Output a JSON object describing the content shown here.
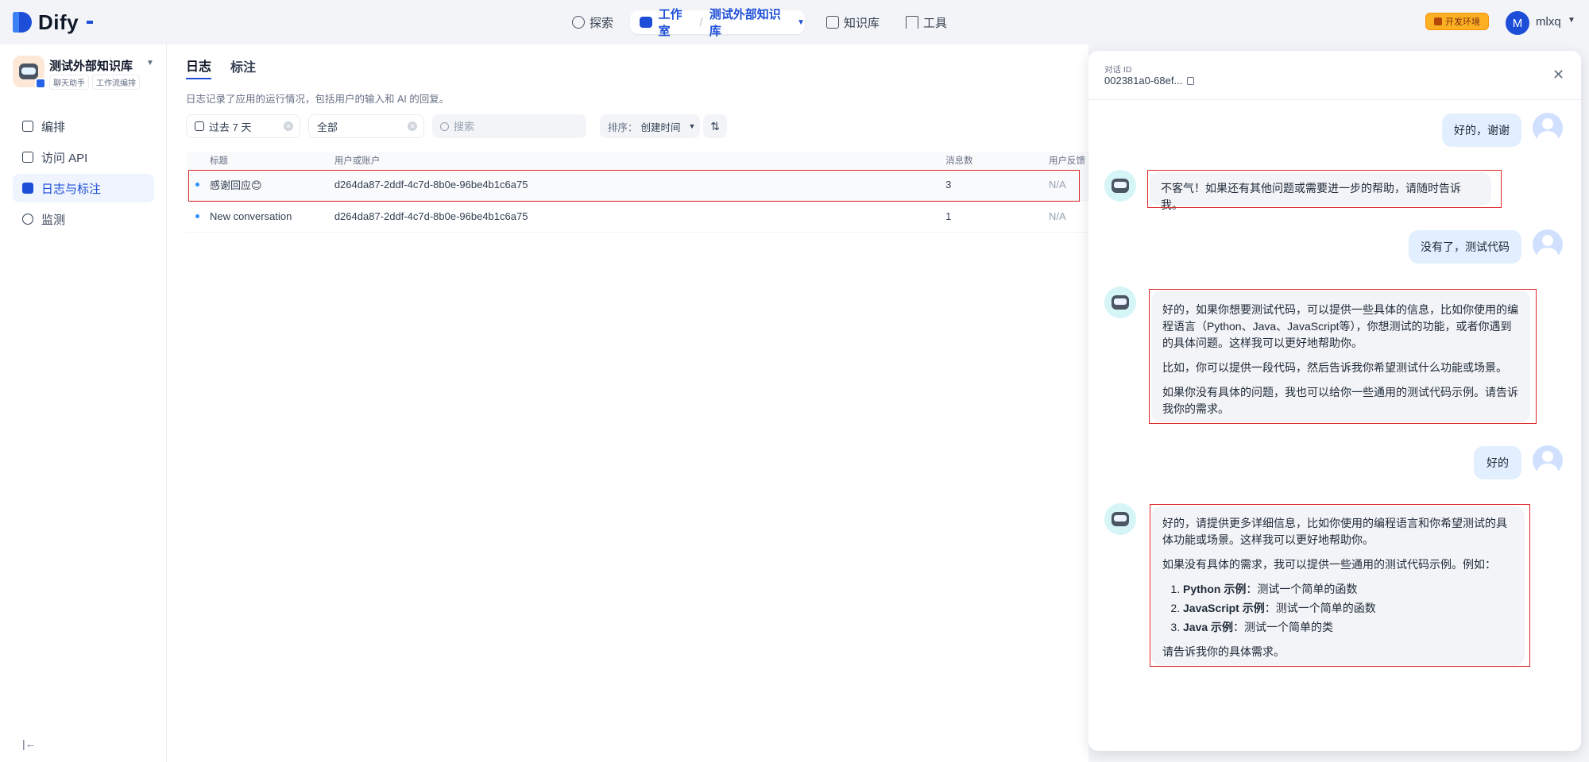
{
  "nav": {
    "logo_text": "Dify",
    "explore": "探索",
    "studio": "工作室",
    "separator": "/",
    "current_app": "测试外部知识库",
    "knowledge": "知识库",
    "tools": "工具",
    "env_badge": "开发环境",
    "user_initial": "M",
    "user_name": "mlxq"
  },
  "sidebar": {
    "app_name": "测试外部知识库",
    "tags": [
      "聊天助手",
      "工作流编排"
    ],
    "items": [
      {
        "label": "编排"
      },
      {
        "label": "访问 API"
      },
      {
        "label": "日志与标注"
      },
      {
        "label": "监测"
      }
    ]
  },
  "main": {
    "tabs": [
      {
        "label": "日志"
      },
      {
        "label": "标注"
      }
    ],
    "description": "日志记录了应用的运行情况，包括用户的输入和 AI 的回复。",
    "filters": {
      "period": "过去 7 天",
      "status": "全部",
      "search_placeholder": "搜索",
      "sort_label": "排序：",
      "sort_value": "创建时间"
    },
    "table": {
      "headers": {
        "title": "标题",
        "user": "用户或账户",
        "messages": "消息数",
        "feedback": "用户反馈"
      },
      "rows": [
        {
          "title": "感谢回应😊",
          "user": "d264da87-2ddf-4c7d-8b0e-96be4b1c6a75",
          "messages": "3",
          "feedback": "N/A"
        },
        {
          "title": "New conversation",
          "user": "d264da87-2ddf-4c7d-8b0e-96be4b1c6a75",
          "messages": "1",
          "feedback": "N/A"
        }
      ]
    }
  },
  "drawer": {
    "conv_label": "对话 ID",
    "conv_id": "002381a0-68ef...",
    "messages": {
      "q1": "好的，谢谢",
      "a1": "不客气！如果还有其他问题或需要进一步的帮助，请随时告诉我。",
      "q2": "没有了，测试代码",
      "a2_p1": "好的，如果你想要测试代码，可以提供一些具体的信息，比如你使用的编程语言（Python、Java、JavaScript等），你想测试的功能，或者你遇到的具体问题。这样我可以更好地帮助你。",
      "a2_p2": "比如，你可以提供一段代码，然后告诉我你希望测试什么功能或场景。",
      "a2_p3": "如果你没有具体的问题，我也可以给你一些通用的测试代码示例。请告诉我你的需求。",
      "q3": "好的",
      "a3_p1": "好的，请提供更多详细信息，比如你使用的编程语言和你希望测试的具体功能或场景。这样我可以更好地帮助你。",
      "a3_p2": "如果没有具体的需求，我可以提供一些通用的测试代码示例。例如：",
      "a3_list": [
        {
          "name": "Python 示例",
          "desc": "：测试一个简单的函数"
        },
        {
          "name": "JavaScript 示例",
          "desc": "：测试一个简单的函数"
        },
        {
          "name": "Java 示例",
          "desc": "：测试一个简单的类"
        }
      ],
      "a3_p3": "请告诉我你的具体需求。"
    }
  },
  "colors": {
    "accent": "#1d4ed8",
    "highlight": "#dc2626",
    "env_badge": "#fdb022"
  }
}
